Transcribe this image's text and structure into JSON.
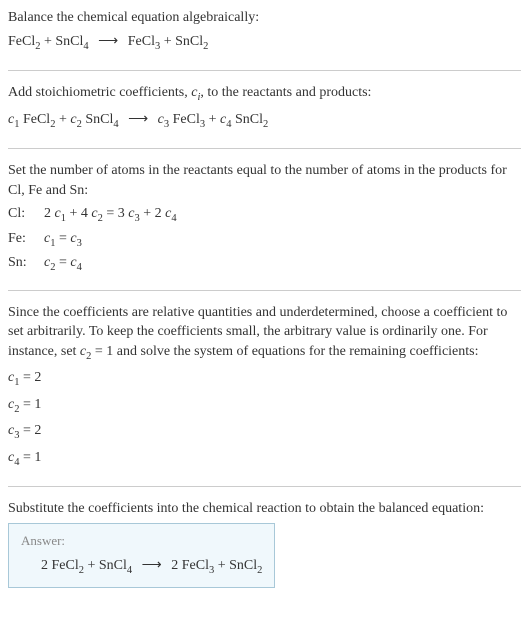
{
  "chart_data": {
    "type": "table",
    "reaction": {
      "reactants": [
        {
          "species": "FeCl2",
          "coeff": 2
        },
        {
          "species": "SnCl4",
          "coeff": 1
        }
      ],
      "products": [
        {
          "species": "FeCl3",
          "coeff": 2
        },
        {
          "species": "SnCl2",
          "coeff": 1
        }
      ]
    },
    "atom_balance": [
      {
        "element": "Cl",
        "equation": "2 c1 + 4 c2 = 3 c3 + 2 c4"
      },
      {
        "element": "Fe",
        "equation": "c1 = c3"
      },
      {
        "element": "Sn",
        "equation": "c2 = c4"
      }
    ],
    "solution": {
      "c1": 2,
      "c2": 1,
      "c3": 2,
      "c4": 1
    }
  },
  "s1": {
    "title": "Balance the chemical equation algebraically:",
    "eq_html": "FeCl<sub>2</sub> + SnCl<sub>4</sub> <span class='arrow'>⟶</span> FeCl<sub>3</sub> + SnCl<sub>2</sub>"
  },
  "s2": {
    "text_html": "Add stoichiometric coefficients, <span class='ital'>c<sub>i</sub></span>, to the reactants and products:",
    "eq_html": "<span class='ital'>c</span><sub>1</sub> FeCl<sub>2</sub> + <span class='ital'>c</span><sub>2</sub> SnCl<sub>4</sub> <span class='arrow'>⟶</span> <span class='ital'>c</span><sub>3</sub> FeCl<sub>3</sub> + <span class='ital'>c</span><sub>4</sub> SnCl<sub>2</sub>"
  },
  "s3": {
    "text": "Set the number of atoms in the reactants equal to the number of atoms in the products for Cl, Fe and Sn:",
    "rows": [
      {
        "label": "Cl:",
        "eq_html": "2 <span class='ital'>c</span><sub>1</sub> + 4 <span class='ital'>c</span><sub>2</sub> = 3 <span class='ital'>c</span><sub>3</sub> + 2 <span class='ital'>c</span><sub>4</sub>"
      },
      {
        "label": "Fe:",
        "eq_html": "<span class='ital'>c</span><sub>1</sub> = <span class='ital'>c</span><sub>3</sub>"
      },
      {
        "label": "Sn:",
        "eq_html": "<span class='ital'>c</span><sub>2</sub> = <span class='ital'>c</span><sub>4</sub>"
      }
    ]
  },
  "s4": {
    "text_html": "Since the coefficients are relative quantities and underdetermined, choose a coefficient to set arbitrarily. To keep the coefficients small, the arbitrary value is ordinarily one. For instance, set <span class='ital'>c</span><sub>2</sub> = 1 and solve the system of equations for the remaining coefficients:",
    "lines": [
      "<span class='ital'>c</span><sub>1</sub> = 2",
      "<span class='ital'>c</span><sub>2</sub> = 1",
      "<span class='ital'>c</span><sub>3</sub> = 2",
      "<span class='ital'>c</span><sub>4</sub> = 1"
    ]
  },
  "s5": {
    "text": "Substitute the coefficients into the chemical reaction to obtain the balanced equation:",
    "answer_label": "Answer:",
    "answer_eq_html": "2 FeCl<sub>2</sub> + SnCl<sub>4</sub> <span class='arrow'>⟶</span> 2 FeCl<sub>3</sub> + SnCl<sub>2</sub>"
  }
}
